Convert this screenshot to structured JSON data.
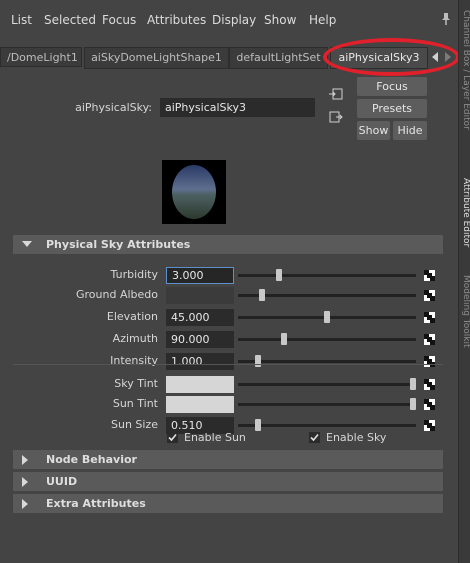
{
  "menubar": {
    "items": [
      "List",
      "Selected",
      "Focus",
      "Attributes",
      "Display",
      "Show",
      "Help"
    ]
  },
  "tabs": [
    {
      "label": "/DomeLight1"
    },
    {
      "label": "aiSkyDomeLightShape1"
    },
    {
      "label": "defaultLightSet"
    },
    {
      "label": "aiPhysicalSky3",
      "active": true
    }
  ],
  "side_tabs": [
    "Channel Box / Layer Editor",
    "Attribute Editor",
    "Modeling Toolkit"
  ],
  "node": {
    "label": "aiPhysicalSky:",
    "name": "aiPhysicalSky3",
    "focus_label": "Focus",
    "presets_label": "Presets",
    "show_label": "Show",
    "hide_label": "Hide"
  },
  "sections": {
    "physical_sky": "Physical Sky Attributes",
    "node_behavior": "Node Behavior",
    "uuid": "UUID",
    "extra": "Extra Attributes"
  },
  "attributes": [
    {
      "label": "Turbidity",
      "value": "3.000",
      "slider": 0.22,
      "focused": true
    },
    {
      "label": "Ground Albedo",
      "value": "",
      "slider": 0.12,
      "swatch": "#3b3b3b"
    },
    {
      "label": "Elevation",
      "value": "45.000",
      "slider": 0.5
    },
    {
      "label": "Azimuth",
      "value": "90.000",
      "slider": 0.25
    },
    {
      "label": "Intensity",
      "value": "1.000",
      "slider": 0.1
    },
    {
      "label": "Sky Tint",
      "value": "",
      "slider": 1.0,
      "swatch": "#d6d6d6"
    },
    {
      "label": "Sun Tint",
      "value": "",
      "slider": 1.0,
      "swatch": "#d6d6d6"
    },
    {
      "label": "Sun Size",
      "value": "0.510",
      "slider": 0.1
    }
  ],
  "checkboxes": [
    {
      "label": "Enable Sun",
      "checked": true
    },
    {
      "label": "Enable Sky",
      "checked": true
    }
  ],
  "colors": {
    "annotation": "#e0202a",
    "focus_border": "#5d8fc8"
  }
}
